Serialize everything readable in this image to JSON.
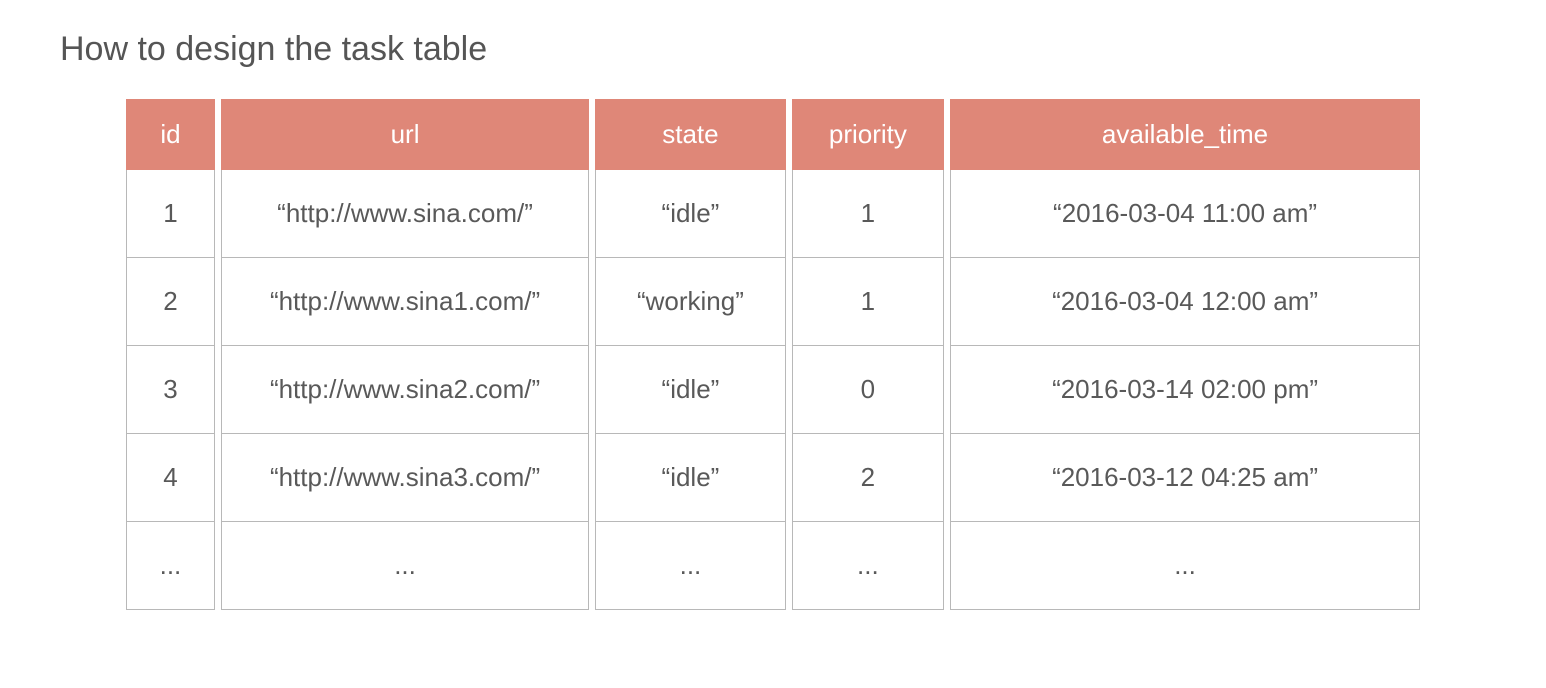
{
  "title": "How to design the task table",
  "headers": {
    "id": "id",
    "url": "url",
    "state": "state",
    "priority": "priority",
    "available_time": "available_time"
  },
  "rows": [
    {
      "id": "1",
      "url": "“http://www.sina.com/”",
      "state": "“idle”",
      "priority": "1",
      "available_time": "“2016-03-04 11:00 am”"
    },
    {
      "id": "2",
      "url": "“http://www.sina1.com/”",
      "state": "“working”",
      "priority": "1",
      "available_time": "“2016-03-04 12:00 am”"
    },
    {
      "id": "3",
      "url": "“http://www.sina2.com/”",
      "state": "“idle”",
      "priority": "0",
      "available_time": "“2016-03-14 02:00 pm”"
    },
    {
      "id": "4",
      "url": "“http://www.sina3.com/”",
      "state": "“idle”",
      "priority": "2",
      "available_time": "“2016-03-12 04:25 am”"
    },
    {
      "id": "...",
      "url": "...",
      "state": "...",
      "priority": "...",
      "available_time": "..."
    }
  ]
}
